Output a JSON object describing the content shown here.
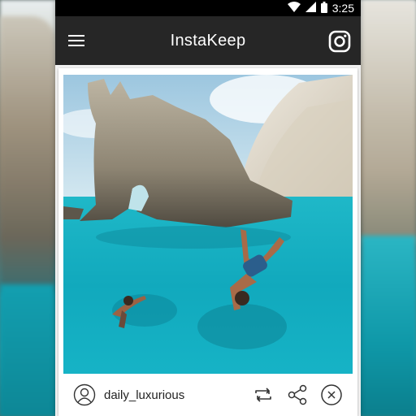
{
  "status_bar": {
    "time": "3:25"
  },
  "app_bar": {
    "title": "InstaKeep",
    "menu_icon": "hamburger-menu-icon",
    "instagram_icon": "instagram-icon"
  },
  "post": {
    "image_desc_icon": "photo",
    "username": "daily_luxurious",
    "actions": [
      "repost-icon",
      "share-icon",
      "close-icon"
    ]
  },
  "colors": {
    "app_bar": "#262626",
    "status_bar": "#000000",
    "water": "#18b6c6"
  }
}
